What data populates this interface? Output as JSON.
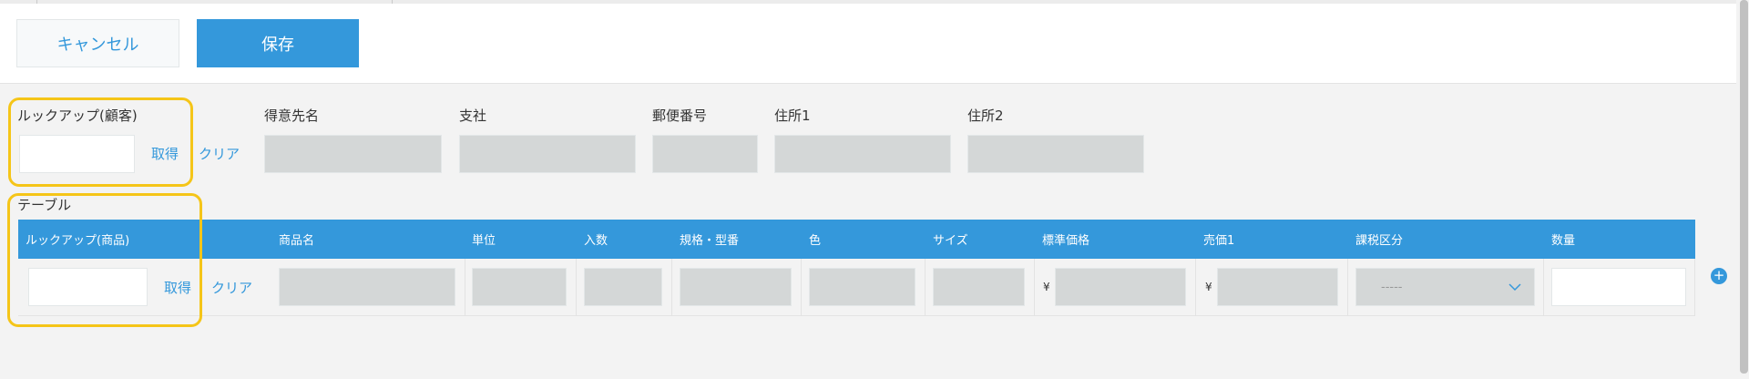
{
  "toolbar": {
    "cancel_label": "キャンセル",
    "save_label": "保存"
  },
  "customer": {
    "lookup_label": "ルックアップ(顧客)",
    "lookup_value": "",
    "get_label": "取得",
    "clear_label": "クリア",
    "fields": [
      {
        "label": "得意先名",
        "value": ""
      },
      {
        "label": "支社",
        "value": ""
      },
      {
        "label": "郵便番号",
        "value": ""
      },
      {
        "label": "住所1",
        "value": ""
      },
      {
        "label": "住所2",
        "value": ""
      }
    ]
  },
  "table": {
    "label": "テーブル",
    "columns": [
      "ルックアップ(商品)",
      "商品名",
      "単位",
      "入数",
      "規格・型番",
      "色",
      "サイズ",
      "標準価格",
      "売価1",
      "課税区分",
      "数量"
    ],
    "row": {
      "lookup_value": "",
      "get_label": "取得",
      "clear_label": "クリア",
      "currency_symbol": "¥",
      "tax_select_value": "-----",
      "quantity_value": ""
    },
    "add_row_label": "+"
  },
  "colors": {
    "accent": "#3498db",
    "highlight": "#f5c518",
    "readonly_field": "#d4d7d7",
    "background": "#f3f3f3"
  },
  "icons": {
    "dropdown": "chevron-down-icon",
    "add": "plus-circle-icon"
  }
}
